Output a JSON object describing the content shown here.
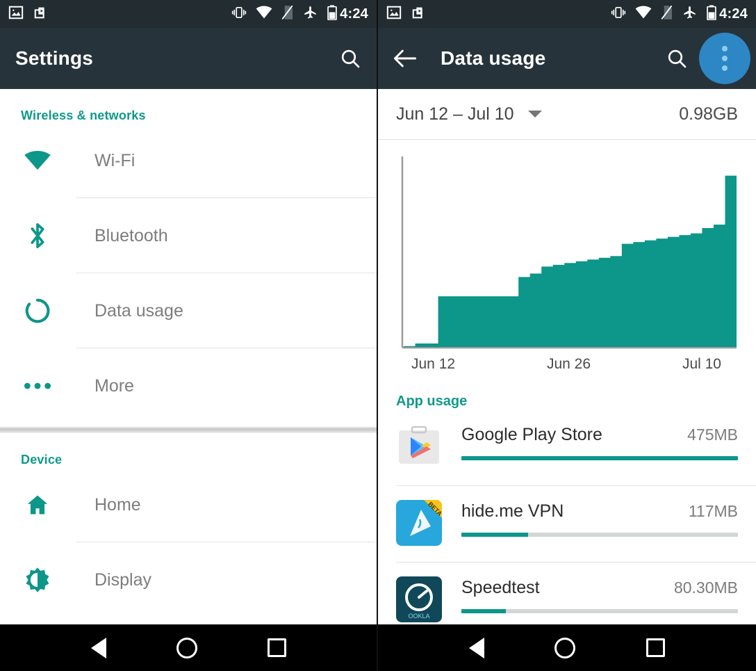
{
  "theme": {
    "teal": "#0d968a",
    "toolbar_bg": "#27333a",
    "statusbar_bg": "#222c31",
    "accent_blue": "#2c87c4",
    "navbar_bg": "#000000"
  },
  "status_bar": {
    "clock": "4:24",
    "left_icons": [
      "image-icon",
      "video-capture-icon"
    ],
    "right_icons": [
      "vibrate-icon",
      "wifi-icon",
      "no-sim-icon",
      "airplane-mode-icon",
      "battery-icon"
    ]
  },
  "left_panel": {
    "toolbar": {
      "title": "Settings",
      "search_icon": "search-icon"
    },
    "sections": [
      {
        "header": "Wireless & networks",
        "items": [
          {
            "label": "Wi-Fi",
            "icon": "wifi-icon"
          },
          {
            "label": "Bluetooth",
            "icon": "bluetooth-icon"
          },
          {
            "label": "Data usage",
            "icon": "data-usage-icon"
          },
          {
            "label": "More",
            "icon": "more-horizontal-icon"
          }
        ]
      },
      {
        "header": "Device",
        "items": [
          {
            "label": "Home",
            "icon": "home-icon"
          },
          {
            "label": "Display",
            "icon": "brightness-icon"
          }
        ]
      }
    ]
  },
  "right_panel": {
    "toolbar": {
      "title": "Data usage",
      "back_icon": "back-arrow-icon",
      "search_icon": "search-icon",
      "overflow_icon": "overflow-menu-icon"
    },
    "cycle": {
      "range_label": "Jun 12 – Jul 10",
      "dropdown_icon": "chevron-down-icon",
      "total": "0.98GB"
    },
    "app_usage": {
      "header": "App usage",
      "apps": [
        {
          "name": "Google Play Store",
          "size": "475MB",
          "percent": 100,
          "icon": "google-play-store-icon"
        },
        {
          "name": "hide.me VPN",
          "size": "117MB",
          "percent": 24,
          "icon": "hide-me-vpn-icon",
          "badge": "BETA"
        },
        {
          "name": "Speedtest",
          "size": "80.30MB",
          "percent": 16,
          "icon": "speedtest-ookla-icon"
        }
      ]
    }
  },
  "chart_data": {
    "type": "area",
    "title": "Data usage",
    "xlabel": "",
    "ylabel": "",
    "grid": false,
    "legend": null,
    "xlim": [
      "Jun 12",
      "Jul 10"
    ],
    "ylim": [
      0,
      1.05
    ],
    "unit": "GB",
    "axis_tick_labels": [
      "Jun 12",
      "Jun 26",
      "Jul 10"
    ],
    "series_color": "#0d968a",
    "x": [
      "Jun 12",
      "Jun 13",
      "Jun 14",
      "Jun 15",
      "Jun 16",
      "Jun 17",
      "Jun 18",
      "Jun 19",
      "Jun 20",
      "Jun 21",
      "Jun 22",
      "Jun 23",
      "Jun 24",
      "Jun 25",
      "Jun 26",
      "Jun 27",
      "Jun 28",
      "Jun 29",
      "Jun 30",
      "Jul 1",
      "Jul 2",
      "Jul 3",
      "Jul 4",
      "Jul 5",
      "Jul 6",
      "Jul 7",
      "Jul 8",
      "Jul 9",
      "Jul 10"
    ],
    "values": [
      0.005,
      0.02,
      0.02,
      0.29,
      0.29,
      0.29,
      0.29,
      0.29,
      0.29,
      0.29,
      0.4,
      0.42,
      0.46,
      0.47,
      0.48,
      0.49,
      0.5,
      0.51,
      0.52,
      0.59,
      0.6,
      0.61,
      0.62,
      0.63,
      0.64,
      0.65,
      0.68,
      0.7,
      0.98
    ],
    "total_label": "0.98GB"
  },
  "nav_bar": {
    "buttons": [
      {
        "name": "back-button",
        "icon": "triangle-back-icon"
      },
      {
        "name": "home-button",
        "icon": "circle-home-icon"
      },
      {
        "name": "recents-button",
        "icon": "square-recents-icon"
      }
    ]
  }
}
